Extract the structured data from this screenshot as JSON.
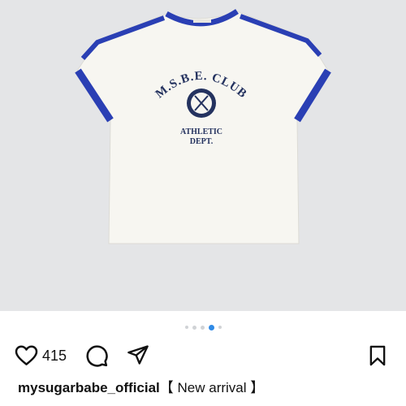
{
  "post": {
    "image": {
      "background_color": "#e4e5e7",
      "shirt_color": "#f7f6f1",
      "trim_color": "#2a3fb4",
      "print_color": "#24325f",
      "print": {
        "arc_text": "M.S.B.E. CLUB",
        "line1": "ATHLETIC",
        "line2": "DEPT."
      }
    },
    "carousel": {
      "total": 5,
      "active_index": 3
    },
    "actions": {
      "like_icon": "heart-icon",
      "like_count": "415",
      "comment_icon": "comment-icon",
      "share_icon": "paper-plane-icon",
      "save_icon": "bookmark-icon"
    },
    "caption": {
      "username": "mysugarbabe_official",
      "text": "【 New arrival 】"
    }
  }
}
